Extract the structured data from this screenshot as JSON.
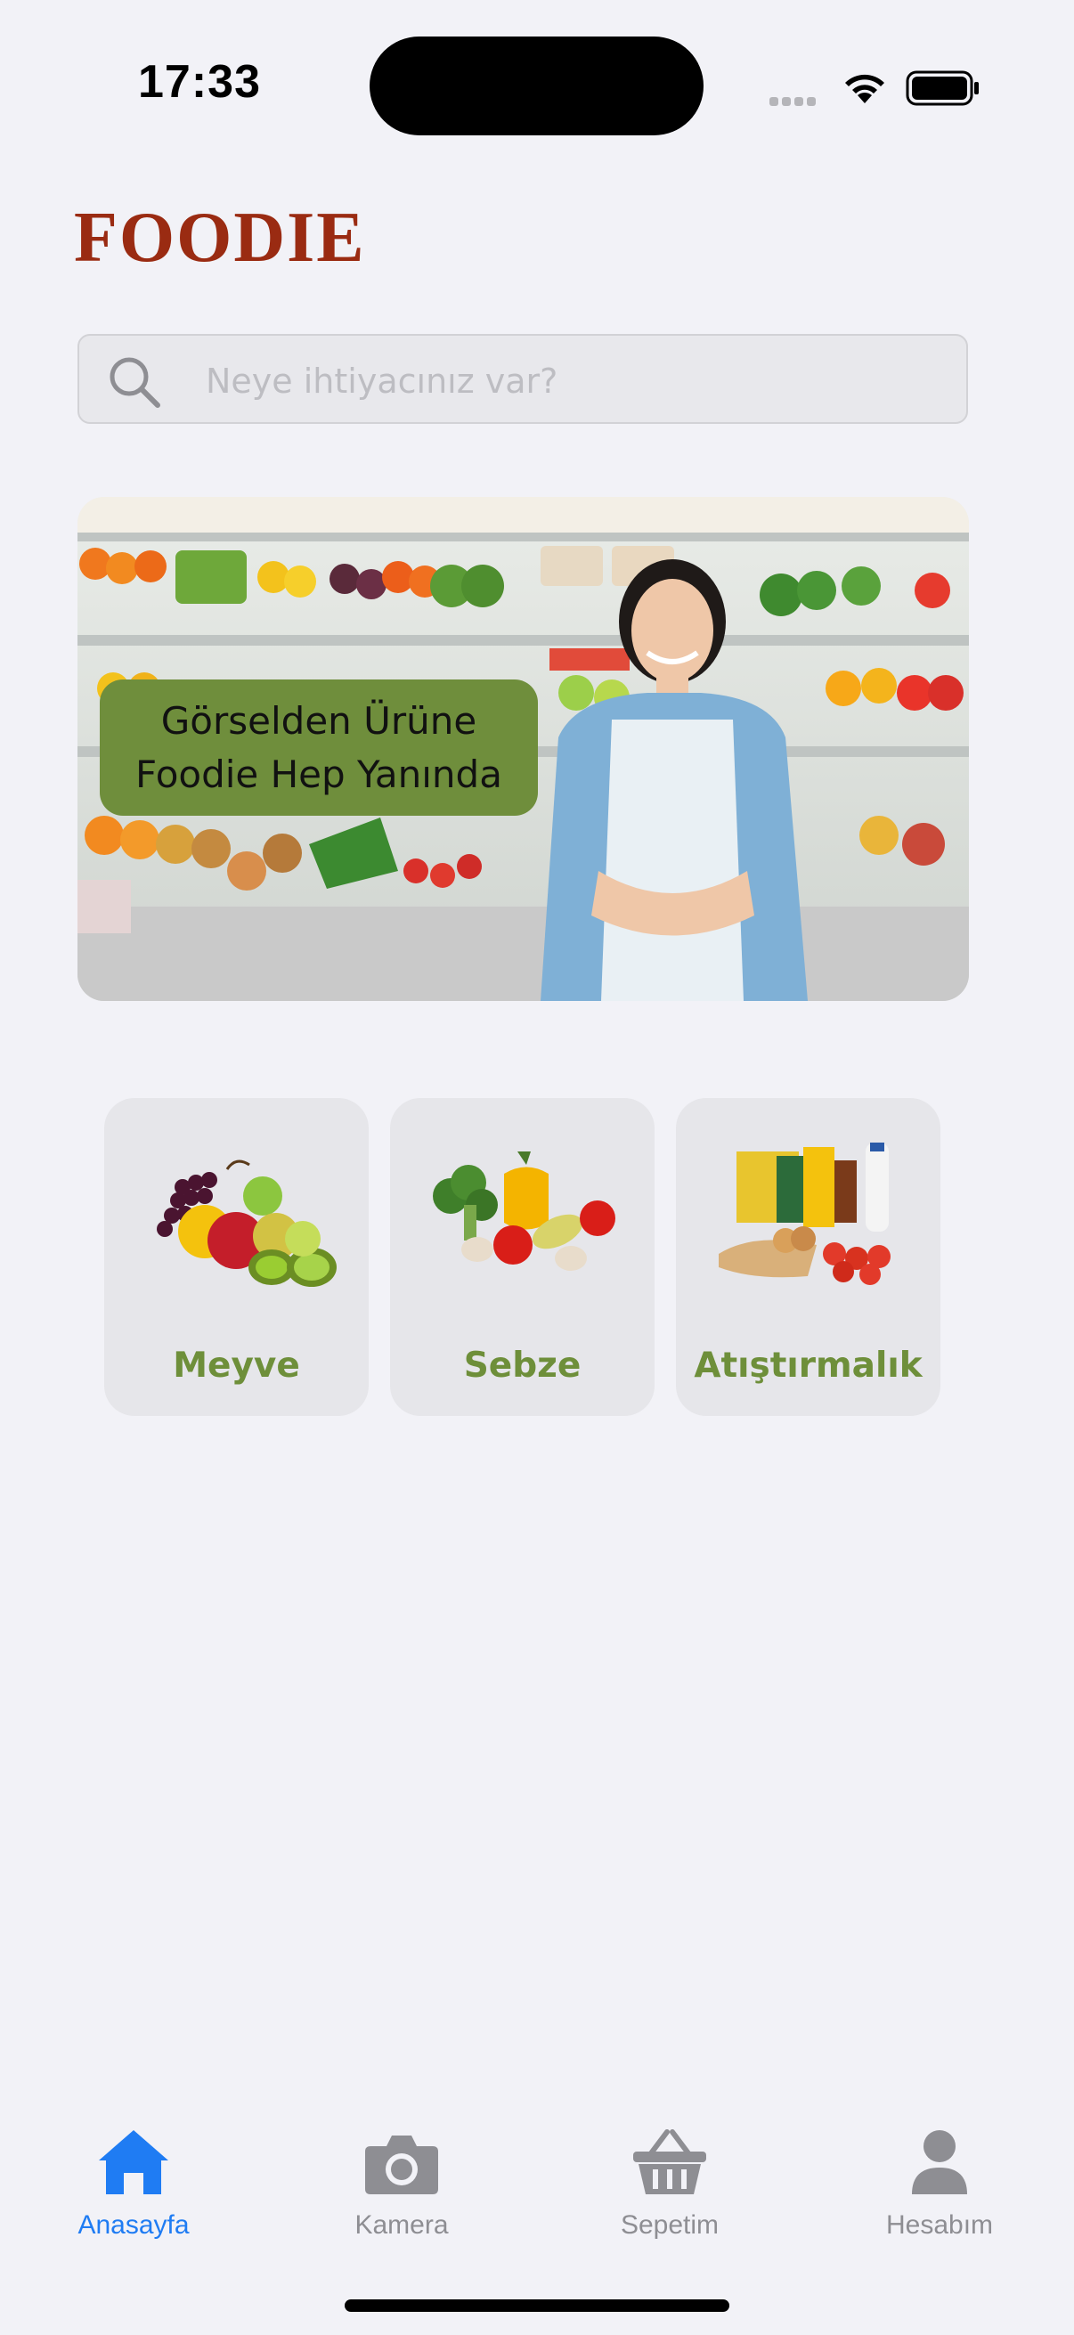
{
  "status_bar": {
    "time": "17:33",
    "icons": [
      "signal-icon",
      "wifi-icon",
      "battery-icon"
    ]
  },
  "app": {
    "title": "FOODIE",
    "brand_color": "#9a2b12"
  },
  "search": {
    "placeholder": "Neye ihtiyacınız var?",
    "value": ""
  },
  "banner": {
    "line1": "Görselden Ürüne",
    "line2": "Foodie Hep Yanında",
    "label_color": "#6f8e3c"
  },
  "categories": [
    {
      "label": "Meyve",
      "icon": "fruit-icon"
    },
    {
      "label": "Sebze",
      "icon": "vegetable-icon"
    },
    {
      "label": "Atıştırmalık",
      "icon": "snack-icon"
    }
  ],
  "tabs": [
    {
      "label": "Anasayfa",
      "icon": "home-icon",
      "active": true
    },
    {
      "label": "Kamera",
      "icon": "camera-icon",
      "active": false
    },
    {
      "label": "Sepetim",
      "icon": "basket-icon",
      "active": false
    },
    {
      "label": "Hesabım",
      "icon": "person-icon",
      "active": false
    }
  ],
  "colors": {
    "accent": "#1f7cf3",
    "category_label": "#6e8f3a",
    "background": "#f2f2f7"
  }
}
